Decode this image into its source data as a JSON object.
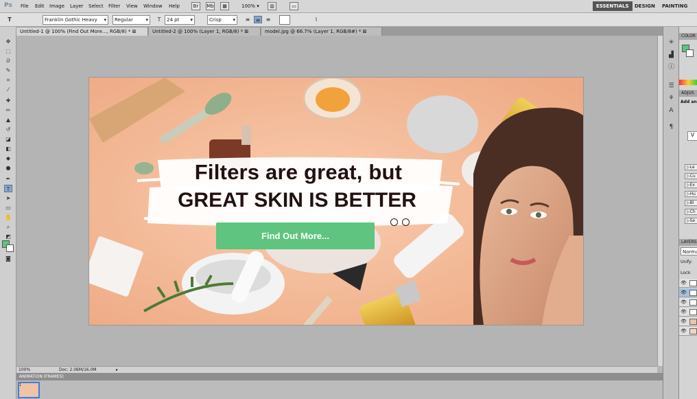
{
  "app": {
    "logo": "Ps"
  },
  "menu": [
    "File",
    "Edit",
    "Image",
    "Layer",
    "Select",
    "Filter",
    "View",
    "Window",
    "Help"
  ],
  "menubar_tools": {
    "zoom": "100%"
  },
  "workspaces": [
    "ESSENTIALS",
    "DESIGN",
    "PAINTING"
  ],
  "options": {
    "font_family": "Franklin Gothic Heavy",
    "font_style": "Regular",
    "font_size": "24 pt",
    "antialias": "Crisp"
  },
  "doc_tabs": [
    "Untitled-1 @ 100% (Find Out More..., RGB/8) *",
    "Untitled-2 @ 100% (Layer 1, RGB/8) *",
    "model.jpg @ 66.7% (Layer 1, RGB/8#) *"
  ],
  "banner": {
    "headline1": "Filters are great, but",
    "headline2": "GREAT SKIN IS BETTER",
    "button": "Find Out More..."
  },
  "status": {
    "zoom": "100%",
    "doc": "Doc: 2.06M/16.0M"
  },
  "animation": {
    "title": "ANIMATION (FRAMES)",
    "frame_label": "1"
  },
  "panels": {
    "color": "COLOR",
    "adjustments": "ADJUS",
    "add": "Add an",
    "list": [
      "Le",
      "Cu",
      "Ex",
      "Hu",
      "Bl",
      "Ch",
      "Se"
    ],
    "layers": "LAYERS",
    "blend": "Norma",
    "unify": "Unify:",
    "lock": "Lock:"
  },
  "colors": {
    "foreground": "#5ec47f",
    "background": "#ffffff",
    "accent": "#5ec47f"
  }
}
